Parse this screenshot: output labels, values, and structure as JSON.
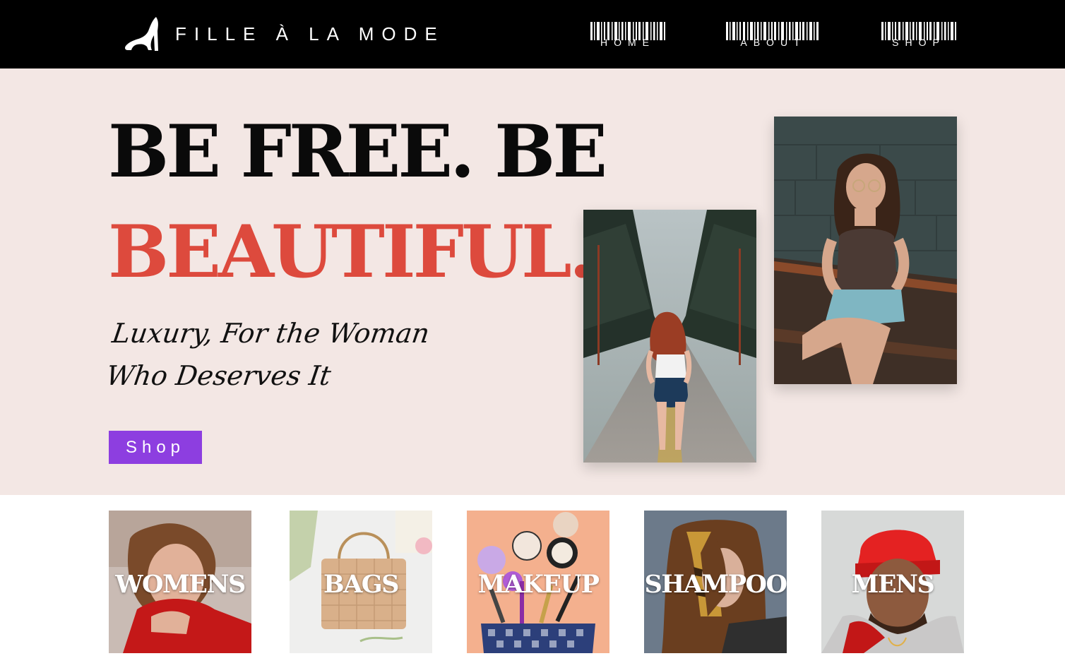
{
  "header": {
    "brand_name": "FILLE À LA MODE",
    "logo_icon": "high-heel-icon",
    "nav": [
      {
        "label": "HOME",
        "icon": "barcode-icon"
      },
      {
        "label": "ABOUT",
        "icon": "barcode-icon"
      },
      {
        "label": "SHOP",
        "icon": "barcode-icon"
      }
    ]
  },
  "hero": {
    "headline_line1": "BE FREE. BE",
    "headline_line2": "BEAUTIFUL.",
    "tagline": "Luxury, For the Woman\nWho Deserves It",
    "cta_label": "Shop",
    "images": [
      {
        "name": "woman-walking-road-photo"
      },
      {
        "name": "woman-sitting-bench-photo"
      }
    ]
  },
  "categories": [
    {
      "label": "WOMENS"
    },
    {
      "label": "BAGS"
    },
    {
      "label": "MAKEUP"
    },
    {
      "label": "SHAMPOO"
    },
    {
      "label": "MENS"
    }
  ],
  "colors": {
    "header_bg": "#000000",
    "hero_bg": "#f3e7e4",
    "headline_dark": "#0a0a0a",
    "headline_accent": "#dd4a3d",
    "cta_bg": "#8d3ee0"
  }
}
